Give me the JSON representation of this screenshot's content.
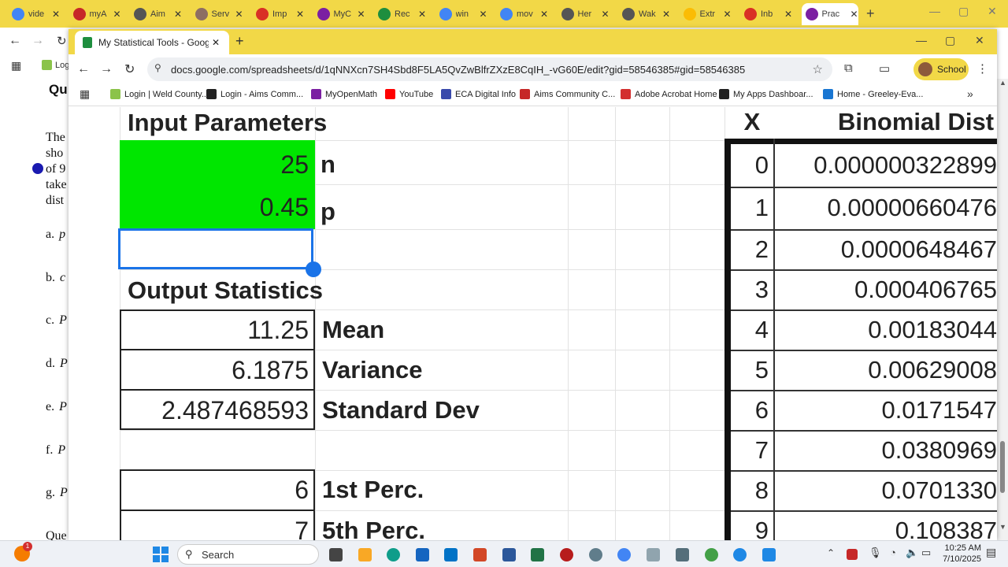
{
  "outer_browser": {
    "tabs": [
      {
        "label": "vide",
        "icon": "google-icon",
        "color": "#4285f4"
      },
      {
        "label": "myA",
        "icon": "myaims-icon",
        "color": "#c62828"
      },
      {
        "label": "Aim",
        "icon": "aims-icon",
        "color": "#555555"
      },
      {
        "label": "Serv",
        "icon": "service-icon",
        "color": "#8d6e63"
      },
      {
        "label": "Imp",
        "icon": "gmail-icon",
        "color": "#d93025"
      },
      {
        "label": "MyC",
        "icon": "mymath-icon",
        "color": "#7b1fa2"
      },
      {
        "label": "Rec",
        "icon": "sheets-icon",
        "color": "#1e8e3e"
      },
      {
        "label": "win",
        "icon": "google-icon",
        "color": "#4285f4"
      },
      {
        "label": "mov",
        "icon": "google-icon",
        "color": "#4285f4"
      },
      {
        "label": "Her",
        "icon": "bookmark-icon",
        "color": "#555555"
      },
      {
        "label": "Wak",
        "icon": "bookmark-icon",
        "color": "#555555"
      },
      {
        "label": "Extr",
        "icon": "drive-icon",
        "color": "#fbbc04"
      },
      {
        "label": "Inb",
        "icon": "gmail-icon",
        "color": "#d93025"
      },
      {
        "label": "Prac",
        "icon": "mymath-icon",
        "color": "#7b1fa2",
        "active": true
      }
    ],
    "bookmark_stub": "Log",
    "page_text": {
      "heading": "Qu",
      "lines": [
        "The",
        "sho",
        "of 9",
        "take",
        "dist"
      ],
      "items": [
        "a.",
        "b.",
        "c.",
        "d.",
        "e.",
        "f.",
        "g."
      ],
      "item_marks": [
        "p",
        "c",
        "P",
        "P",
        "P",
        "P",
        "P"
      ],
      "bottom": "Que"
    }
  },
  "inner_browser": {
    "tab_title": "My Statistical Tools - Google Sh",
    "url": "docs.google.com/spreadsheets/d/1qNNXcn7SH4Sbd8F5LA5QvZwBlfrZXzE8CqIH_-vG60E/edit?gid=58546385#gid=58546385",
    "profile": "School",
    "bookmarks": [
      {
        "label": "Login | Weld County...",
        "color": "#8bc34a"
      },
      {
        "label": "Login - Aims Comm...",
        "color": "#222222"
      },
      {
        "label": "MyOpenMath",
        "color": "#7b1fa2"
      },
      {
        "label": "YouTube",
        "color": "#ff0000"
      },
      {
        "label": "ECA Digital Info",
        "color": "#3949ab"
      },
      {
        "label": "Aims Community C...",
        "color": "#c62828"
      },
      {
        "label": "Adobe Acrobat Home",
        "color": "#d32f2f"
      },
      {
        "label": "My Apps Dashboar...",
        "color": "#222222"
      },
      {
        "label": "Home - Greeley-Eva...",
        "color": "#1976d2"
      }
    ]
  },
  "sheet": {
    "input_title": "Input Parameters",
    "n_value": "25",
    "n_label": "n",
    "p_value": "0.45",
    "p_label": "p",
    "output_title": "Output Statistics",
    "mean_value": "11.25",
    "mean_label": "Mean",
    "variance_value": "6.1875",
    "variance_label": "Variance",
    "sd_value": "2.487468593",
    "sd_label": "Standard Dev",
    "p1_value": "6",
    "p1_label": "1st Perc.",
    "p5_value": "7",
    "p5_label": "5th Perc.",
    "x_header": "X",
    "dist_header": "Binomial Dist",
    "rows": [
      {
        "x": "0",
        "p": "0.000000322899"
      },
      {
        "x": "1",
        "p": "0.00000660476"
      },
      {
        "x": "2",
        "p": "0.0000648467"
      },
      {
        "x": "3",
        "p": "0.000406765"
      },
      {
        "x": "4",
        "p": "0.00183044"
      },
      {
        "x": "5",
        "p": "0.00629008"
      },
      {
        "x": "6",
        "p": "0.0171547"
      },
      {
        "x": "7",
        "p": "0.0380969"
      },
      {
        "x": "8",
        "p": "0.0701330"
      },
      {
        "x": "9",
        "p": "0.108387"
      }
    ],
    "input_fill": "#00e600",
    "selection_color": "#1a73e8"
  },
  "taskbar": {
    "search": "Search",
    "time": "10:25 AM",
    "date": "7/10/2025",
    "notification_count": "1"
  }
}
